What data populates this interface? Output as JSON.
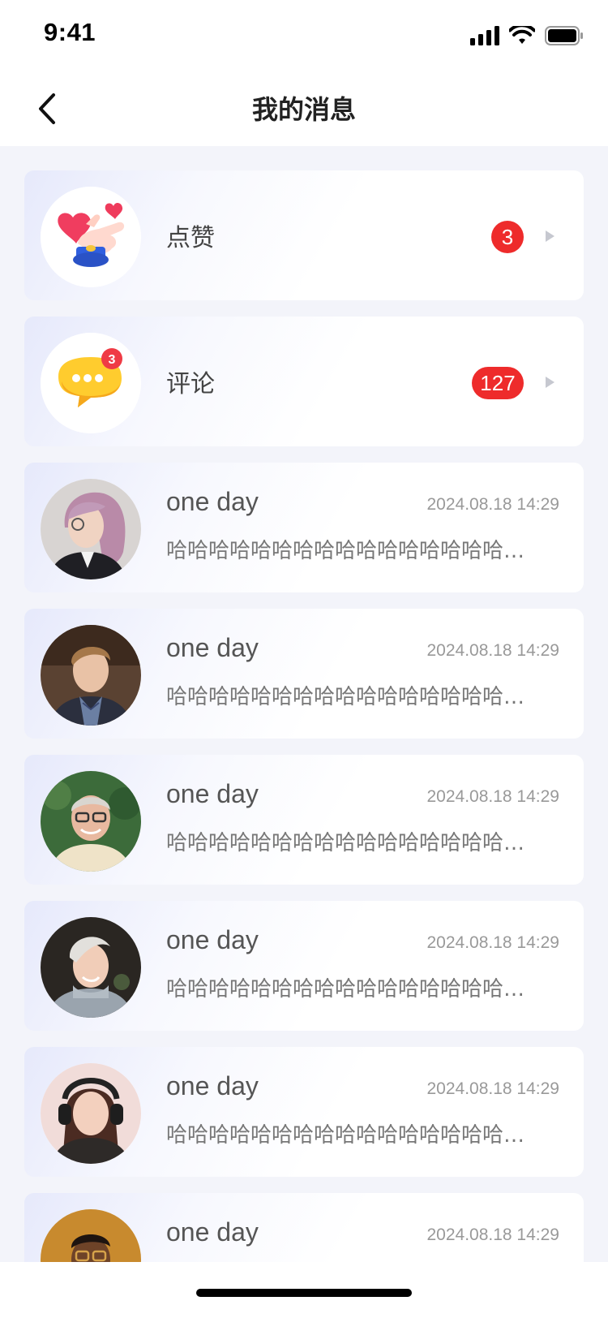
{
  "status_bar": {
    "time": "9:41"
  },
  "header": {
    "title": "我的消息"
  },
  "categories": [
    {
      "label": "点赞",
      "badge": "3",
      "icon": "thumbs-up-heart-icon"
    },
    {
      "label": "评论",
      "badge": "127",
      "icon": "chat-bubble-icon",
      "icon_badge": "3"
    }
  ],
  "messages": [
    {
      "name": "one day",
      "time": "2024.08.18 14:29",
      "text": "哈哈哈哈哈哈哈哈哈哈哈哈哈哈哈哈哈哈哈哈哈"
    },
    {
      "name": "one day",
      "time": "2024.08.18 14:29",
      "text": "哈哈哈哈哈哈哈哈哈哈哈哈哈哈哈哈哈哈哈哈哈"
    },
    {
      "name": "one day",
      "time": "2024.08.18 14:29",
      "text": "哈哈哈哈哈哈哈哈哈哈哈哈哈哈哈哈哈哈哈哈哈"
    },
    {
      "name": "one day",
      "time": "2024.08.18 14:29",
      "text": "哈哈哈哈哈哈哈哈哈哈哈哈哈哈哈哈哈哈哈哈哈"
    },
    {
      "name": "one day",
      "time": "2024.08.18 14:29",
      "text": "哈哈哈哈哈哈哈哈哈哈哈哈哈哈哈哈哈哈哈哈哈"
    },
    {
      "name": "one day",
      "time": "2024.08.18 14:29",
      "text": ""
    }
  ],
  "colors": {
    "badge": "#ee2b2b",
    "background": "#f3f4fa",
    "card_tint": "#e6e9fb"
  }
}
